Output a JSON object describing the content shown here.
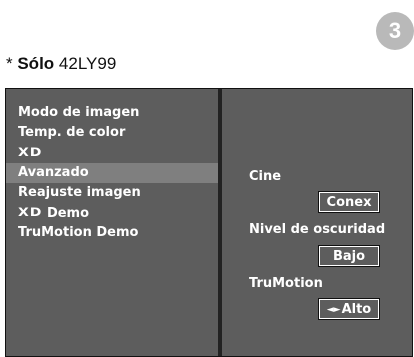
{
  "step_badge": "3",
  "note": {
    "prefix": "* ",
    "bold": "Sólo",
    "model": "42LY99"
  },
  "menu": {
    "items": [
      {
        "label": "Modo de imagen"
      },
      {
        "label": "Temp. de color"
      },
      {
        "label": "XD",
        "is_logo": true
      },
      {
        "label": "Avanzado",
        "selected": true
      },
      {
        "label": "Reajuste imagen"
      },
      {
        "label": "Demo",
        "logo_prefix": "XD"
      },
      {
        "label": "TruMotion Demo"
      }
    ]
  },
  "options": {
    "cine": {
      "label": "Cine",
      "value": "Conex"
    },
    "nivel": {
      "label": "Nivel de oscuridad",
      "value": "Bajo"
    },
    "trumotion": {
      "label": "TruMotion",
      "value": "Alto",
      "value_icon": "left-right-arrows-icon",
      "arrows": "◄►"
    }
  },
  "colors": {
    "panel_bg": "#5d5d5d",
    "selected_bg": "#7f7f7f",
    "text": "#ffffff",
    "badge": "#b9b9b9"
  }
}
